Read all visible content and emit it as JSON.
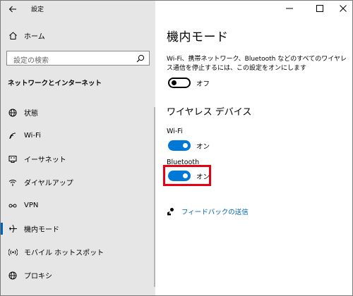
{
  "app": {
    "title": "設定"
  },
  "sidebar": {
    "home_label": "ホーム",
    "search_placeholder": "設定の検索",
    "section_heading": "ネットワークとインターネット",
    "items": [
      {
        "label": "状態",
        "icon": "globe-icon"
      },
      {
        "label": "Wi-Fi",
        "icon": "wifi-icon"
      },
      {
        "label": "イーサネット",
        "icon": "ethernet-icon"
      },
      {
        "label": "ダイヤルアップ",
        "icon": "dialup-icon"
      },
      {
        "label": "VPN",
        "icon": "vpn-icon"
      },
      {
        "label": "機内モード",
        "icon": "airplane-icon",
        "selected": true
      },
      {
        "label": "モバイル ホットスポット",
        "icon": "hotspot-icon"
      },
      {
        "label": "プロキシ",
        "icon": "globe-icon"
      }
    ]
  },
  "main": {
    "title": "機内モード",
    "description": "Wi-Fi、携帯ネットワーク、Bluetooth などのすべてのワイヤレス通信を停止するには、この設定をオンにします",
    "airplane_toggle": {
      "state": "off",
      "label": "オフ"
    },
    "wireless_heading": "ワイヤレス デバイス",
    "wifi": {
      "label": "Wi-Fi",
      "state": "on",
      "state_label": "オン"
    },
    "bluetooth": {
      "label": "Bluetooth",
      "state": "on",
      "state_label": "オン"
    },
    "feedback_link": "フィードバックの送信"
  },
  "colors": {
    "accent": "#0078d7",
    "highlight": "#e60012",
    "sidebar_bg": "#e6e6e6"
  }
}
